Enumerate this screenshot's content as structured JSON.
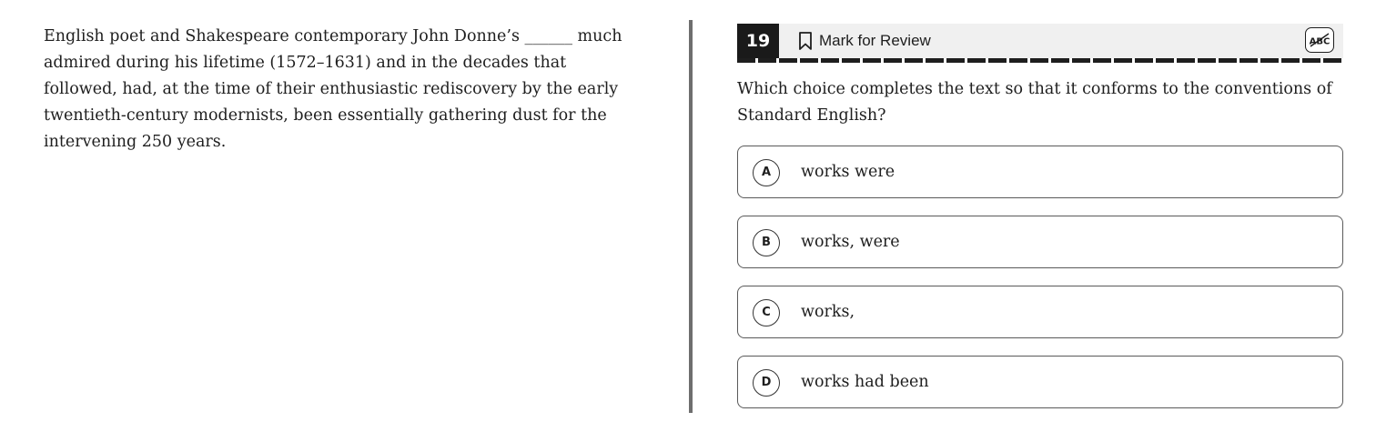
{
  "passage": {
    "text": "English poet and Shakespeare contemporary John Donne’s ______ much admired during his lifetime (1572–1631) and in the decades that followed, had, at the time of their enthusiastic rediscovery by the early twentieth-century modernists, been essentially gathering dust for the intervening 250 years."
  },
  "question": {
    "number": "19",
    "mark_for_review_label": "Mark for Review",
    "prompt": "Which choice completes the text so that it conforms to the conventions of Standard English?",
    "abc_tool_label": "ABC",
    "choices": [
      {
        "letter": "A",
        "text": "works were"
      },
      {
        "letter": "B",
        "text": "works, were"
      },
      {
        "letter": "C",
        "text": "works,"
      },
      {
        "letter": "D",
        "text": "works had been"
      }
    ]
  },
  "icons": {
    "bookmark": "bookmark-icon",
    "abc_strikethrough": "abc-strikethrough-icon"
  },
  "colors": {
    "header_background": "#f0f0f0",
    "number_background": "#1a1a1a",
    "divider": "#6e6e6e",
    "text": "#1e1e1e"
  }
}
